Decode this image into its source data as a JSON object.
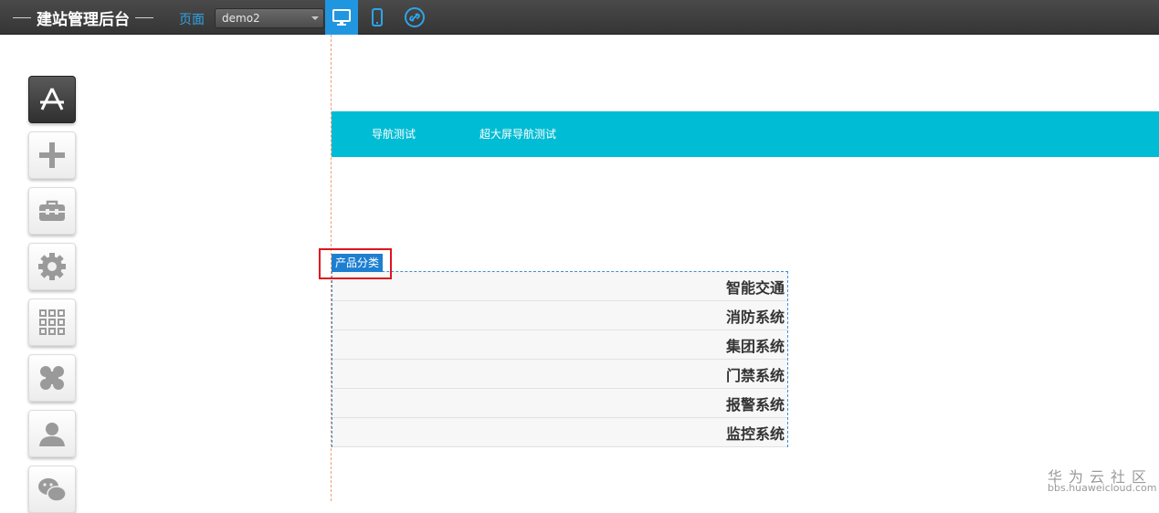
{
  "header": {
    "title": "建站管理后台",
    "page_label": "页面",
    "page_select": {
      "value": "demo2"
    },
    "device_buttons": [
      {
        "name": "desktop",
        "icon": "monitor-icon",
        "active": true
      },
      {
        "name": "mobile",
        "icon": "phone-icon",
        "active": false
      },
      {
        "name": "link",
        "icon": "link-icon",
        "active": false
      }
    ]
  },
  "colors": {
    "topbar": "#3e3e3e",
    "accent": "#2196e0",
    "nav_bar": "#00bcd4",
    "highlight": "#e0141e",
    "tag": "#1e7fd1"
  },
  "sidebar": {
    "tools": [
      {
        "icon": "app-store-icon",
        "active": true
      },
      {
        "icon": "plus-icon",
        "active": false
      },
      {
        "icon": "toolbox-icon",
        "active": false
      },
      {
        "icon": "gear-icon",
        "active": false
      },
      {
        "icon": "grid-icon",
        "active": false
      },
      {
        "icon": "clover-icon",
        "active": false
      },
      {
        "icon": "user-icon",
        "active": false
      },
      {
        "icon": "wechat-icon",
        "active": false
      }
    ]
  },
  "canvas": {
    "nav_items": [
      "导航测试",
      "超大屏导航测试"
    ],
    "category_widget": {
      "tag": "产品分类",
      "items": [
        "智能交通",
        "消防系统",
        "集团系统",
        "门禁系统",
        "报警系统",
        "监控系统"
      ]
    }
  },
  "watermark": {
    "title": "华为云社区",
    "url": "bbs.huaweicloud.com"
  }
}
